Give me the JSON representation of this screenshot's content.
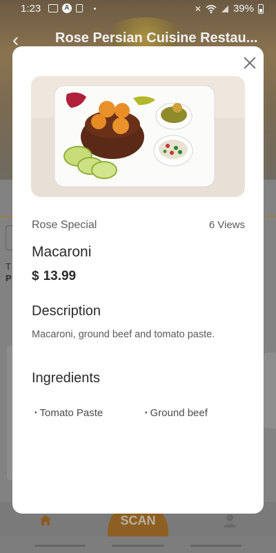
{
  "status_bar": {
    "time": "1:23",
    "battery": "39%"
  },
  "background": {
    "restaurant_title": "Rose Persian Cuisine Restau...",
    "scan_label": "SCAN",
    "partial_text_1": "T",
    "partial_text_2": "P"
  },
  "dish": {
    "category": "Rose Special",
    "views_count": "6",
    "views_label": "Views",
    "name": "Macaroni",
    "currency": "$",
    "price": "13.99",
    "description_heading": "Description",
    "description": "Macaroni, ground beef and tomato paste.",
    "ingredients_heading": "Ingredients",
    "ingredients": [
      "Tomato Paste",
      "Ground beef"
    ]
  },
  "colors": {
    "accent": "#c57a2a",
    "modal_bg": "#ffffff",
    "text_dark": "#2a2a2a",
    "text_muted": "#5a5a5a"
  }
}
